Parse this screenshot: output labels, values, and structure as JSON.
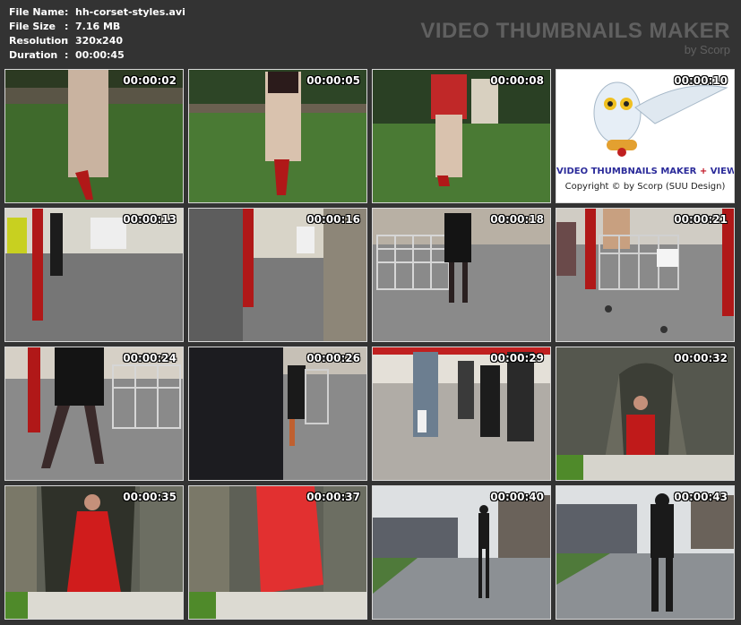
{
  "info": {
    "rows": [
      {
        "key": "File Name",
        "value": "hh-corset-styles.avi"
      },
      {
        "key": "File Size",
        "value": "7.16 MB"
      },
      {
        "key": "Resolution",
        "value": "320x240"
      },
      {
        "key": "Duration",
        "value": "00:00:45"
      }
    ],
    "colon": ":"
  },
  "brand": {
    "title": "VIDEO THUMBNAILS MAKER",
    "subtitle": "by Scorp"
  },
  "logo": {
    "line1_a": "VIDEO THUMBNAILS MAKER",
    "line1_plus": "+",
    "line1_b": "VIEWER",
    "line2": "Copyright © by Scorp (SUU Design)"
  },
  "thumbnails": [
    {
      "time": "00:00:02"
    },
    {
      "time": "00:00:05"
    },
    {
      "time": "00:00:08"
    },
    {
      "time": "00:00:10"
    },
    {
      "time": "00:00:13"
    },
    {
      "time": "00:00:16"
    },
    {
      "time": "00:00:18"
    },
    {
      "time": "00:00:21"
    },
    {
      "time": "00:00:24"
    },
    {
      "time": "00:00:26"
    },
    {
      "time": "00:00:29"
    },
    {
      "time": "00:00:32"
    },
    {
      "time": "00:00:35"
    },
    {
      "time": "00:00:37"
    },
    {
      "time": "00:00:40"
    },
    {
      "time": "00:00:43"
    }
  ]
}
